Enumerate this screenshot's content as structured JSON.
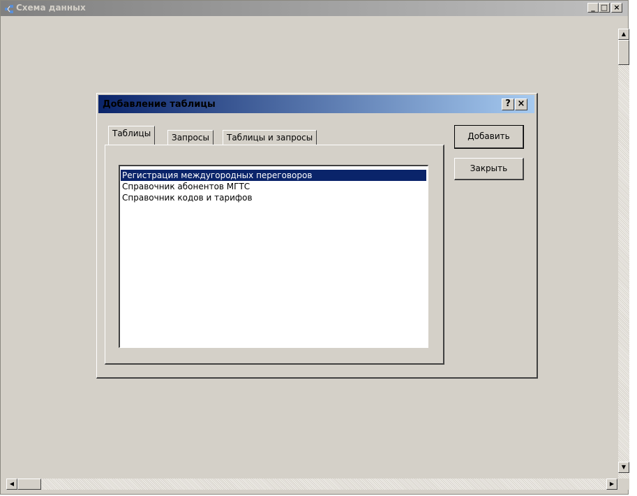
{
  "window": {
    "title": "Схема данных",
    "minimize_glyph": "_",
    "maximize_glyph": "□",
    "close_glyph": "×"
  },
  "scrollbars": {
    "up_glyph": "▲",
    "down_glyph": "▼",
    "left_glyph": "◀",
    "right_glyph": "▶"
  },
  "dialog": {
    "title": "Добавление таблицы",
    "help_glyph": "?",
    "close_glyph": "×",
    "tabs": [
      {
        "label": "Таблицы",
        "active": true
      },
      {
        "label": "Запросы",
        "active": false
      },
      {
        "label": "Таблицы и запросы",
        "active": false
      }
    ],
    "list": [
      {
        "label": "Регистрация междугородных переговоров",
        "selected": true
      },
      {
        "label": "Справочник абонентов МГТС",
        "selected": false
      },
      {
        "label": "Справочник кодов и тарифов",
        "selected": false
      }
    ],
    "buttons": {
      "add": "Добавить",
      "close": "Закрыть"
    }
  },
  "colors": {
    "face": "#d4d0c8",
    "dialog_title_start": "#0a246a",
    "dialog_title_end": "#a6caf0",
    "selection": "#0a246a"
  },
  "icons": [
    "relationships-icon",
    "help-icon",
    "close-icon",
    "minimize-icon",
    "maximize-icon"
  ]
}
